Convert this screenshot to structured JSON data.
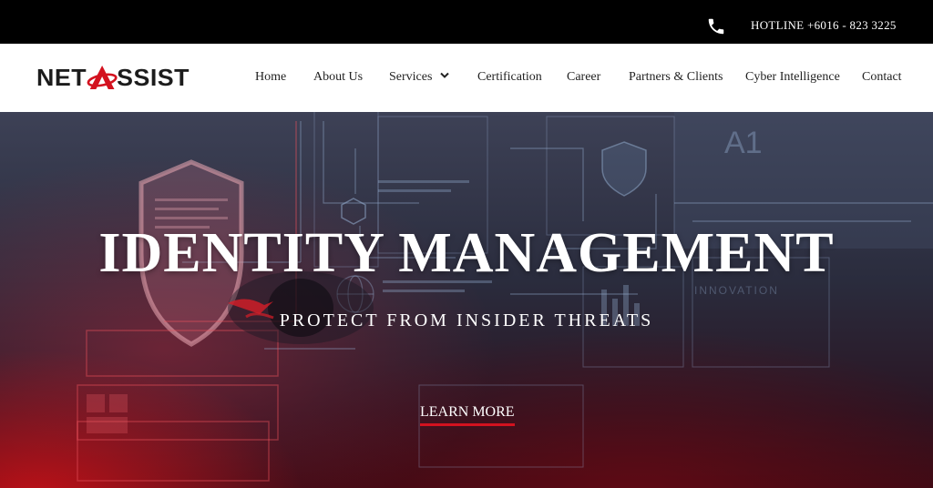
{
  "topbar": {
    "hotline": "HOTLINE +6016 - 823 3225",
    "phone_icon": "phone-icon"
  },
  "header": {
    "logo": {
      "part1": "NET",
      "part2": "SSIST",
      "accent_color": "#d3121f",
      "text_color": "#1c1c1c"
    },
    "nav": [
      {
        "label": "Home"
      },
      {
        "label": "About Us"
      },
      {
        "label": "Services",
        "has_dropdown": true,
        "icon": "chevron-down-icon"
      },
      {
        "label": "Certification"
      },
      {
        "label": "Career"
      },
      {
        "label": "Partners & Clients"
      },
      {
        "label": "Cyber Intelligence"
      },
      {
        "label": "Contact"
      }
    ]
  },
  "hero": {
    "title": "IDENTITY MANAGEMENT",
    "subtitle": "PROTECT FROM INSIDER THREATS",
    "cta": "LEARN MORE",
    "background_text_1": "A1",
    "background_text_2": "INNOVATION",
    "accent_color": "#d3121f"
  }
}
